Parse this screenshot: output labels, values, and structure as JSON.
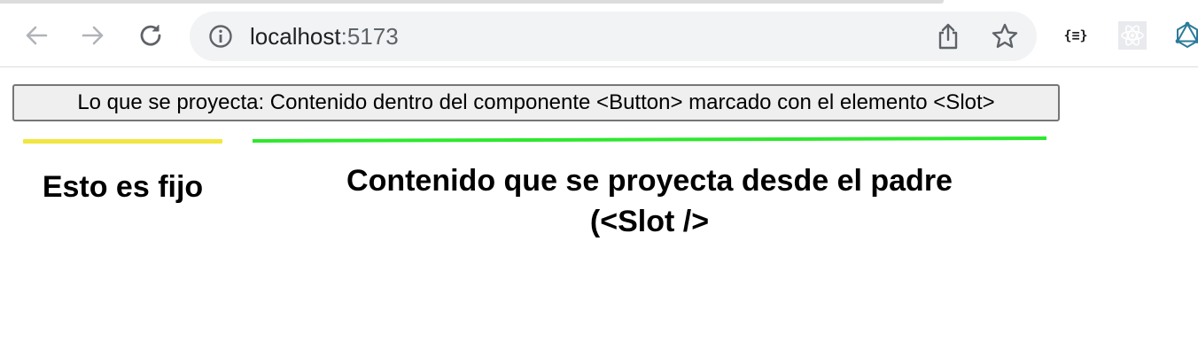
{
  "browser": {
    "url_host": "localhost",
    "url_port": ":5173",
    "extensions": {
      "json_viewer_icon": "{≡}",
      "react_devtools_icon": "react-icon",
      "graph_icon": "graphql-icon"
    },
    "icons": [
      "back-arrow-icon",
      "forward-arrow-icon",
      "reload-icon",
      "info-icon",
      "share-icon",
      "star-icon"
    ]
  },
  "page": {
    "button_label": "Lo que se proyecta: Contenido dentro del componente <Button> marcado con el elemento <Slot>",
    "fixed_label": "Esto es fijo",
    "slot_label": "Contenido que se proyecta desde el padre (<Slot />"
  },
  "colors": {
    "yellow_marker": "#f1e640",
    "green_marker": "#2ee82e"
  }
}
